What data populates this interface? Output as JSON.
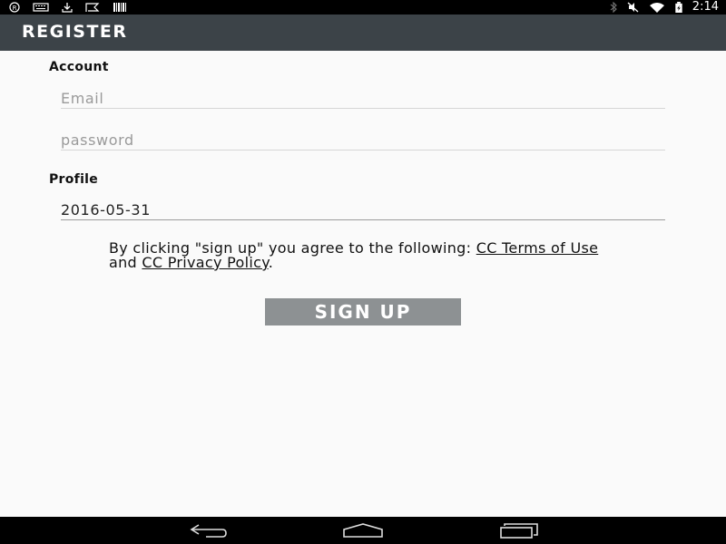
{
  "status_bar": {
    "time": "2:14",
    "left_icons": [
      "registered-icon",
      "keyboard-icon",
      "download-icon",
      "flag-icon",
      "barcode-icon"
    ],
    "right_icons": [
      "bluetooth-icon",
      "mute-icon",
      "wifi-icon",
      "battery-icon"
    ]
  },
  "app_bar": {
    "title": "REGISTER"
  },
  "account": {
    "label": "Account",
    "email_placeholder": "Email",
    "password_placeholder": "password"
  },
  "profile": {
    "label": "Profile",
    "birthdate_value": "2016-05-31"
  },
  "terms": {
    "prefix": "By clicking \"sign up\" you agree to the following: ",
    "terms_link": "CC Terms of Use",
    "middle": " and ",
    "privacy_link": "CC Privacy Policy",
    "suffix": "."
  },
  "signup_button": {
    "label": "SIGN UP"
  },
  "nav_bar": {
    "icons": [
      "back-icon",
      "home-icon",
      "recent-apps-icon"
    ]
  },
  "colors": {
    "app_bar": "#3c4348",
    "background": "#fafafa",
    "button": "#8d9193",
    "system_bars": "#000000"
  }
}
